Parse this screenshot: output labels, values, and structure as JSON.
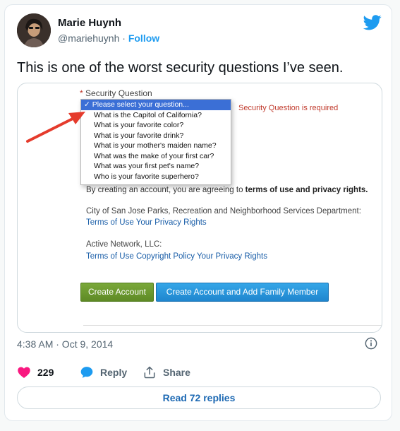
{
  "colors": {
    "twitter_blue": "#1d9bf0",
    "like_pink": "#f91880",
    "reply_blue": "#1d9bf0",
    "error_red": "#c0392b",
    "green_button": "#6a9a2e",
    "blue_button": "#2896dc"
  },
  "author": {
    "name": "Marie Huynh",
    "handle": "@mariehuynh",
    "separator": "·",
    "follow_label": "Follow"
  },
  "tweet": {
    "text": "This is one of the worst security questions I’ve seen."
  },
  "media": {
    "required_marker": "*",
    "security_label": "Security Question",
    "dropdown": {
      "selected_mark": "✓",
      "options": [
        "Please select your question...",
        "What is the Capitol of California?",
        "What is your favorite color?",
        "What is your favorite drink?",
        "What is your mother's maiden name?",
        "What was the make of your first car?",
        "What was your first pet's name?",
        "Who is your favorite superhero?"
      ]
    },
    "error_text": "Security Question is required",
    "agree_prefix": "By creating an account, you are agreeing to ",
    "agree_bold": "terms of use and privacy rights.",
    "dept_name": "City of San Jose Parks, Recreation and Neighborhood Services Department:",
    "dept_link_terms": "Terms of Use",
    "dept_link_privacy": "Your Privacy Rights",
    "active_name": "Active Network, LLC:",
    "active_link_terms": "Terms of Use",
    "active_link_copyright": "Copyright Policy",
    "active_link_privacy": "Your Privacy Rights",
    "create_account_label": "Create Account",
    "create_family_label": "Create Account and Add Family Member"
  },
  "meta": {
    "timestamp": "4:38 AM · Oct 9, 2014",
    "info_icon": "info-icon"
  },
  "actions": {
    "like_count": "229",
    "reply_label": "Reply",
    "share_label": "Share"
  },
  "footer": {
    "read_replies_label": "Read 72 replies"
  }
}
